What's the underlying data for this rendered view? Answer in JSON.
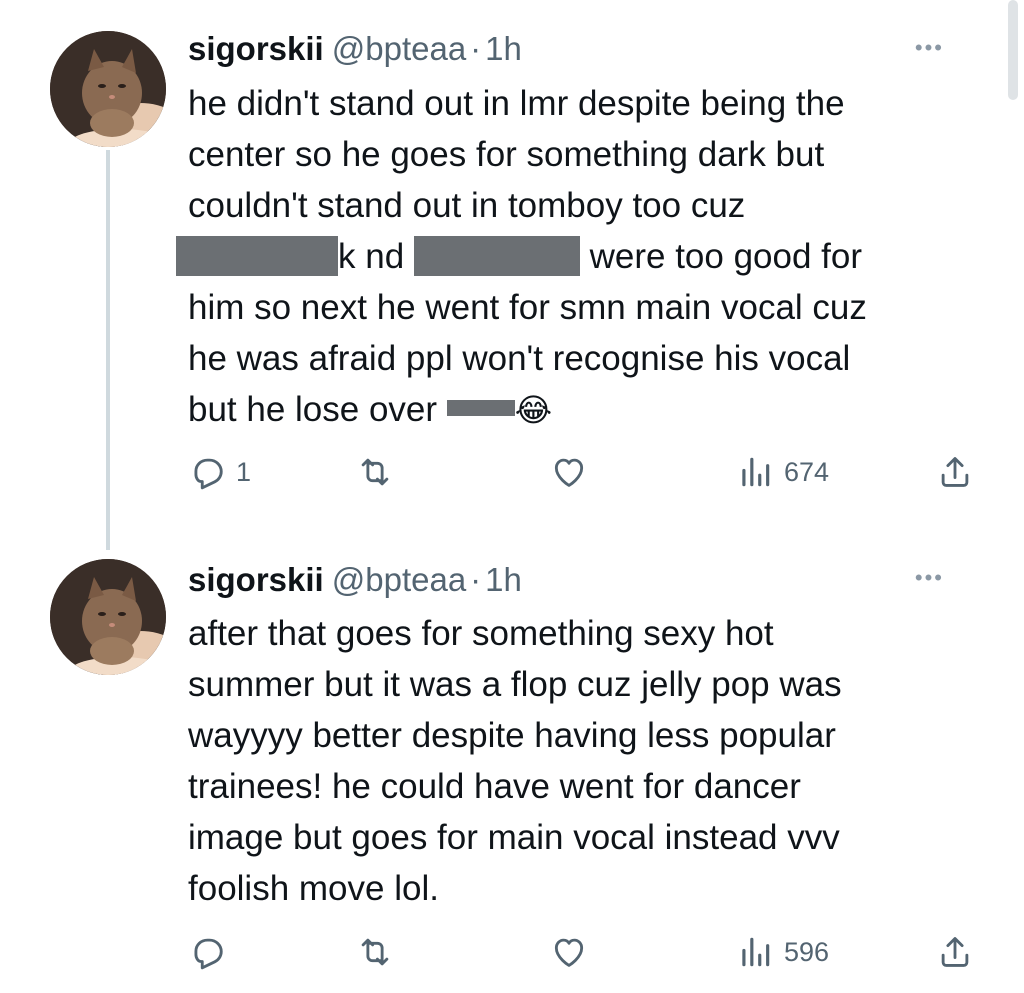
{
  "tweets": [
    {
      "display_name": "sigorskii",
      "handle": "@bpteaa",
      "separator": "·",
      "time": "1h",
      "more_label": "•••",
      "text_lines": [
        "he didn't stand out in lmr despite being the",
        "center so he goes for something dark but",
        "couldn't stand out in tomboy too cuz",
        {
          "before": "",
          "after_first_redaction": "k nd ",
          "after_second_redaction": " were too good for"
        },
        "him so next he went for smn main vocal cuz",
        "he was afraid ppl won't recognise his vocal",
        {
          "before": "but he lose over ",
          "emoji": "😂"
        }
      ],
      "actions": {
        "reply_count": "1",
        "retweet_count": "",
        "like_count": "",
        "views_count": "674"
      }
    },
    {
      "display_name": "sigorskii",
      "handle": "@bpteaa",
      "separator": "·",
      "time": "1h",
      "more_label": "•••",
      "text_lines": [
        "after that goes for something sexy hot",
        "summer but it was a flop cuz jelly pop was",
        "wayyyy better despite having less popular",
        "trainees! he could have went for dancer",
        "image but goes for main vocal instead vvv",
        "foolish move lol."
      ],
      "actions": {
        "reply_count": "",
        "retweet_count": "",
        "like_count": "",
        "views_count": "596"
      }
    }
  ],
  "icons": {
    "reply": "reply-icon",
    "retweet": "retweet-icon",
    "like": "heart-icon",
    "views": "views-chart-icon",
    "share": "share-icon",
    "more": "more-options-icon"
  },
  "colors": {
    "text_primary": "#0f1419",
    "text_secondary": "#536471",
    "thread_line": "#cfd9de",
    "redaction": "#6b6f73"
  }
}
